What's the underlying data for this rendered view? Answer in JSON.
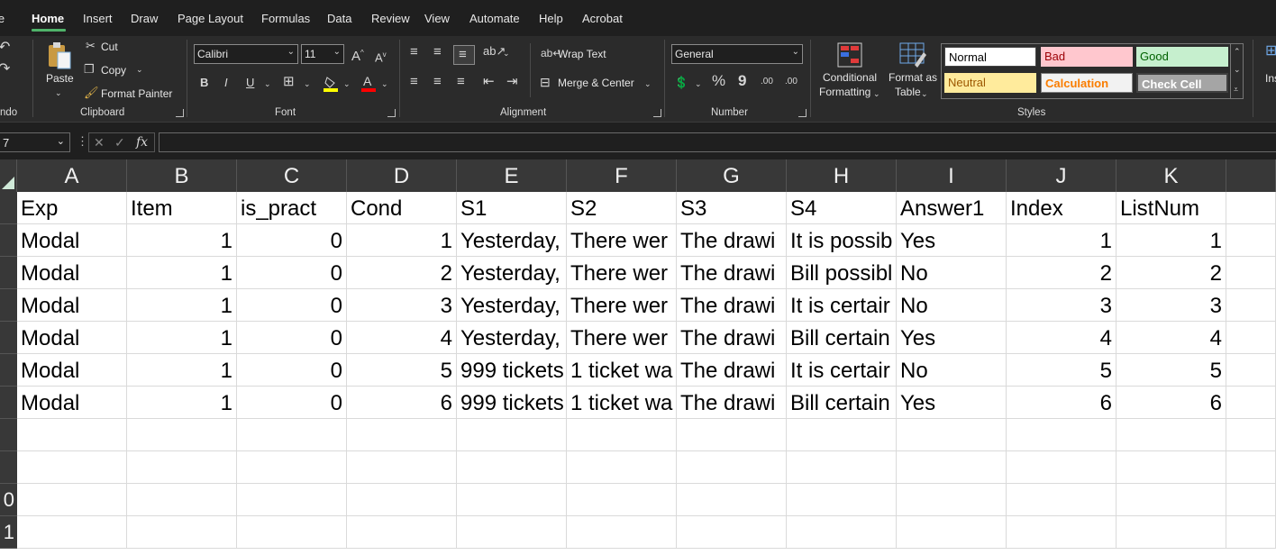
{
  "tabs": [
    "le",
    "Home",
    "Insert",
    "Draw",
    "Page Layout",
    "Formulas",
    "Data",
    "Review",
    "View",
    "Automate",
    "Help",
    "Acrobat"
  ],
  "ribbon": {
    "undo_group": "ndo",
    "clipboard": {
      "paste": "Paste",
      "cut": "Cut",
      "copy": "Copy",
      "format_painter": "Format Painter",
      "group": "Clipboard"
    },
    "font": {
      "name": "Calibri",
      "size": "11",
      "group": "Font"
    },
    "alignment": {
      "wrap": "Wrap Text",
      "merge": "Merge & Center",
      "group": "Alignment"
    },
    "number": {
      "format": "General",
      "group": "Number",
      "percent": "%",
      "comma": "9",
      "inc_dec": ".00",
      "dec_dec": ".00"
    },
    "styles": {
      "conditional_line1": "Conditional",
      "conditional_line2": "Formatting",
      "format_table_line1": "Format as",
      "format_table_line2": "Table",
      "group": "Styles",
      "normal": "Normal",
      "bad": "Bad",
      "good": "Good",
      "neutral": "Neutral",
      "calculation": "Calculation",
      "check_cell": "Check Cell"
    },
    "insert_cut": "Ins"
  },
  "formula_bar": {
    "name_box": "7",
    "fx": "fx",
    "value": ""
  },
  "sheet": {
    "columns": [
      "A",
      "B",
      "C",
      "D",
      "E",
      "F",
      "G",
      "H",
      "I",
      "J",
      "K"
    ],
    "row_headers": [
      "",
      "",
      "",
      "",
      "",
      "",
      "",
      "",
      "",
      "0",
      "1"
    ],
    "rows": [
      [
        "Exp",
        "Item",
        "is_pract",
        "Cond",
        "S1",
        "S2",
        "S3",
        "S4",
        "Answer1",
        "Index",
        "ListNum"
      ],
      [
        "Modal",
        "1",
        "0",
        "1",
        "Yesterday,",
        "There wer",
        "The drawi",
        "It is possib",
        "Yes",
        "1",
        "1"
      ],
      [
        "Modal",
        "1",
        "0",
        "2",
        "Yesterday,",
        "There wer",
        "The drawi",
        "Bill possibl",
        "No",
        "2",
        "2"
      ],
      [
        "Modal",
        "1",
        "0",
        "3",
        "Yesterday,",
        "There wer",
        "The drawi",
        "It is certair",
        "No",
        "3",
        "3"
      ],
      [
        "Modal",
        "1",
        "0",
        "4",
        "Yesterday,",
        "There wer",
        "The drawi",
        "Bill certain",
        "Yes",
        "4",
        "4"
      ],
      [
        "Modal",
        "1",
        "0",
        "5",
        "999 tickets",
        "1 ticket wa",
        "The drawi",
        "It is certair",
        "No",
        "5",
        "5"
      ],
      [
        "Modal",
        "1",
        "0",
        "6",
        "999 tickets",
        "1 ticket wa",
        "The drawi",
        "Bill certain",
        "Yes",
        "6",
        "6"
      ]
    ]
  },
  "colors": {
    "accent": "#4fb36a",
    "ribbon_bg": "#2b2b2b",
    "bad_bg": "#ffc7ce",
    "good_bg": "#c6efce",
    "neutral_bg": "#ffeb9c"
  }
}
